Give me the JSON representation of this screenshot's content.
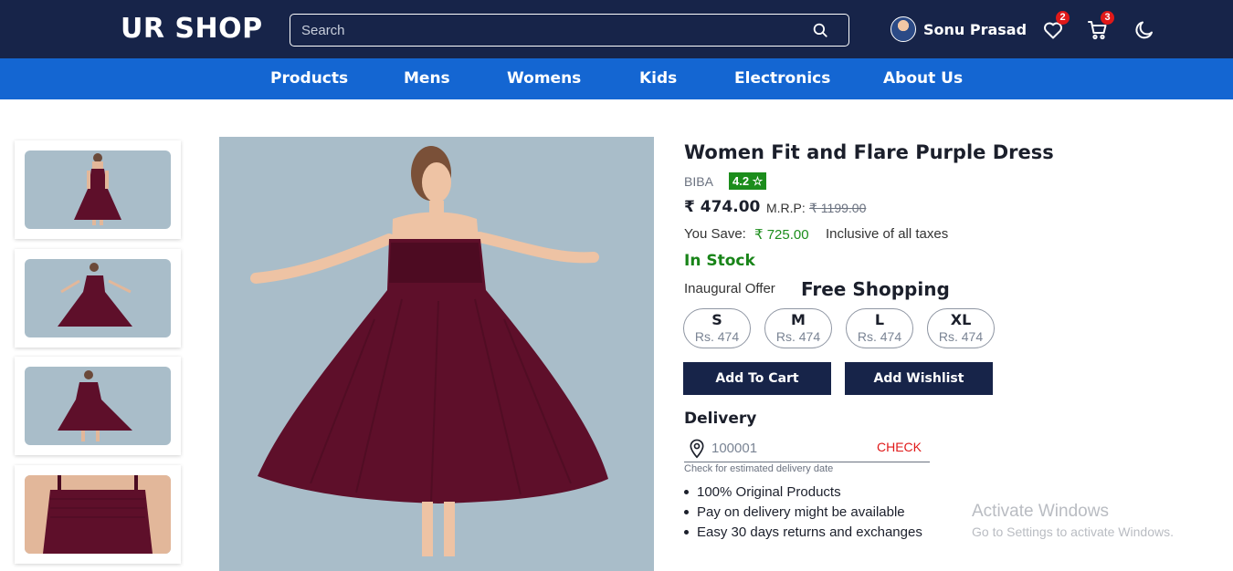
{
  "header": {
    "logo": "UR SHOP",
    "search_placeholder": "Search",
    "user_name": "Sonu Prasad",
    "wishlist_count": "2",
    "cart_count": "3",
    "icons": [
      "search-icon",
      "heart-icon",
      "cart-icon",
      "moon-icon"
    ]
  },
  "nav": {
    "items": [
      "Products",
      "Mens",
      "Womens",
      "Kids",
      "Electronics",
      "About Us"
    ]
  },
  "gallery": {
    "thumbnail_count": 4,
    "bg_color": "#a9bdc9",
    "dress_color": "#5e0f2a"
  },
  "product": {
    "title": "Women Fit and Flare Purple Dress",
    "brand": "BIBA",
    "rating": "4.2 ☆",
    "price": "₹ 474.00",
    "mrp_label": "M.R.P:",
    "mrp": "₹ 1199.00",
    "save_label": "You Save:",
    "save_value": "₹ 725.00",
    "taxes_note": "Inclusive of all taxes",
    "stock_status": "In Stock",
    "offer_label": "Inaugural Offer",
    "offer_value": "Free Shopping",
    "sizes": [
      {
        "size": "S",
        "price": "Rs. 474"
      },
      {
        "size": "M",
        "price": "Rs. 474"
      },
      {
        "size": "L",
        "price": "Rs. 474"
      },
      {
        "size": "XL",
        "price": "Rs. 474"
      }
    ],
    "add_to_cart": "Add To Cart",
    "add_wishlist": "Add Wishlist"
  },
  "delivery": {
    "title": "Delivery",
    "pincode_placeholder": "100001",
    "check_label": "CHECK",
    "help_text": "Check for estimated delivery date",
    "features": [
      "100% Original Products",
      "Pay on delivery might be available",
      "Easy 30 days returns and exchanges"
    ]
  },
  "watermark": {
    "line1": "Activate Windows",
    "line2": "Go to Settings to activate Windows."
  },
  "colors": {
    "header_bg": "#172449",
    "nav_bg": "#1466d2",
    "accent_green": "#1c8d1c",
    "accent_red": "#e01919"
  }
}
